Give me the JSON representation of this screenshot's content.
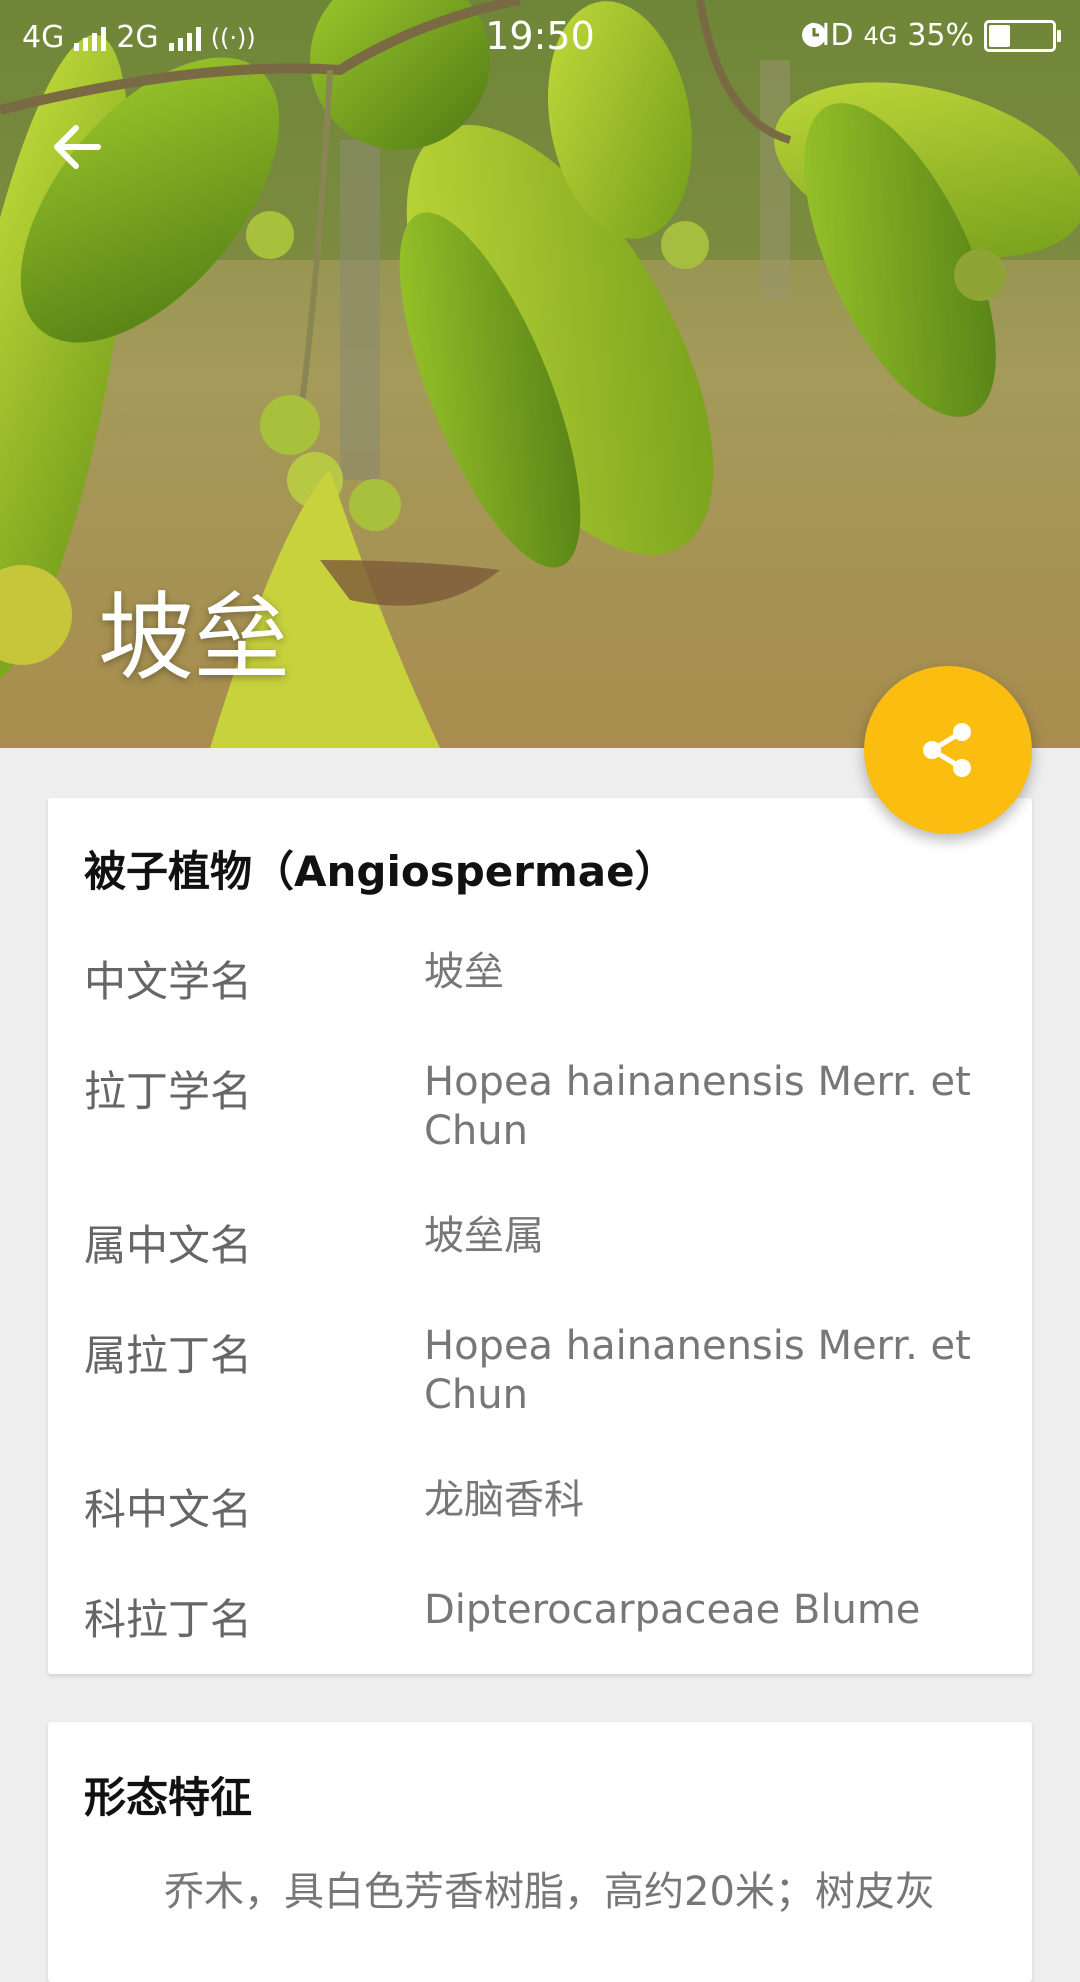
{
  "status_bar": {
    "network_1": "4G",
    "network_2": "2G",
    "time": "19:50",
    "hd": "HD",
    "network_3": "4G",
    "battery": "35%",
    "battery_level": 0.35
  },
  "hero": {
    "title": "坡垒"
  },
  "classification": {
    "heading": "被子植物（Angiospermae）",
    "rows": [
      {
        "label": "中文学名",
        "value": "坡垒"
      },
      {
        "label": "拉丁学名",
        "value": "Hopea hainanensis Merr. et Chun"
      },
      {
        "label": "属中文名",
        "value": "坡垒属"
      },
      {
        "label": "属拉丁名",
        "value": "Hopea hainanensis Merr. et Chun"
      },
      {
        "label": "科中文名",
        "value": "龙脑香科"
      },
      {
        "label": "科拉丁名",
        "value": "Dipterocarpaceae Blume"
      }
    ]
  },
  "morphology": {
    "heading": "形态特征",
    "text": "乔木，具白色芳香树脂，高约20米；树皮灰"
  },
  "colors": {
    "fab": "#fbbd10",
    "background": "#eeeeee"
  }
}
